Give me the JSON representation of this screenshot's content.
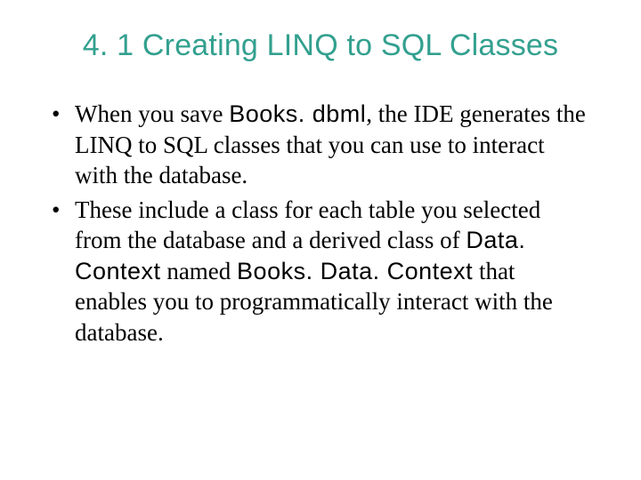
{
  "title": "4. 1 Creating LINQ to SQL Classes",
  "bullets": [
    {
      "pre1": "When you save ",
      "code1": "Books. dbml",
      "post1": ", the IDE generates the LINQ to SQL classes that you can use to interact with the database."
    },
    {
      "pre1": "These include a class for each table you selected from the database and a derived class of ",
      "code1": "Data. Context",
      "mid1": " named ",
      "code2": "Books. Data. Context",
      "post1": " that enables you to programmatically interact with the database."
    }
  ]
}
